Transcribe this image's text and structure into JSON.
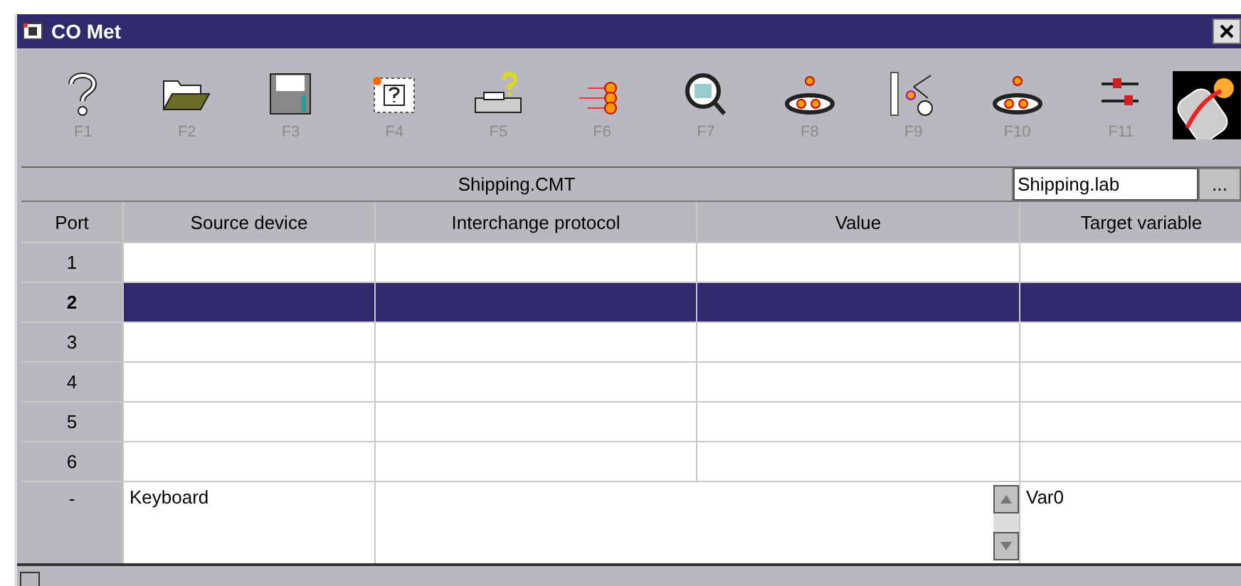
{
  "window": {
    "title": "CO Met"
  },
  "toolbar": [
    {
      "key": "F1"
    },
    {
      "key": "F2"
    },
    {
      "key": "F3"
    },
    {
      "key": "F4"
    },
    {
      "key": "F5"
    },
    {
      "key": "F6"
    },
    {
      "key": "F7"
    },
    {
      "key": "F8"
    },
    {
      "key": "F9"
    },
    {
      "key": "F10"
    },
    {
      "key": "F11"
    }
  ],
  "file_header": {
    "name": "Shipping.CMT",
    "lab_file": "Shipping.lab",
    "browse": "..."
  },
  "table": {
    "columns": [
      "Port",
      "Source device",
      "Interchange protocol",
      "Value",
      "Target variable"
    ],
    "rows": [
      {
        "port": "1",
        "selected": false
      },
      {
        "port": "2",
        "selected": true
      },
      {
        "port": "3",
        "selected": false
      },
      {
        "port": "4",
        "selected": false
      },
      {
        "port": "5",
        "selected": false
      },
      {
        "port": "6",
        "selected": false
      }
    ],
    "edit_row": {
      "port": "-",
      "source": "Keyboard",
      "target": "Var0"
    }
  },
  "status_bar": {
    "checked": false
  }
}
